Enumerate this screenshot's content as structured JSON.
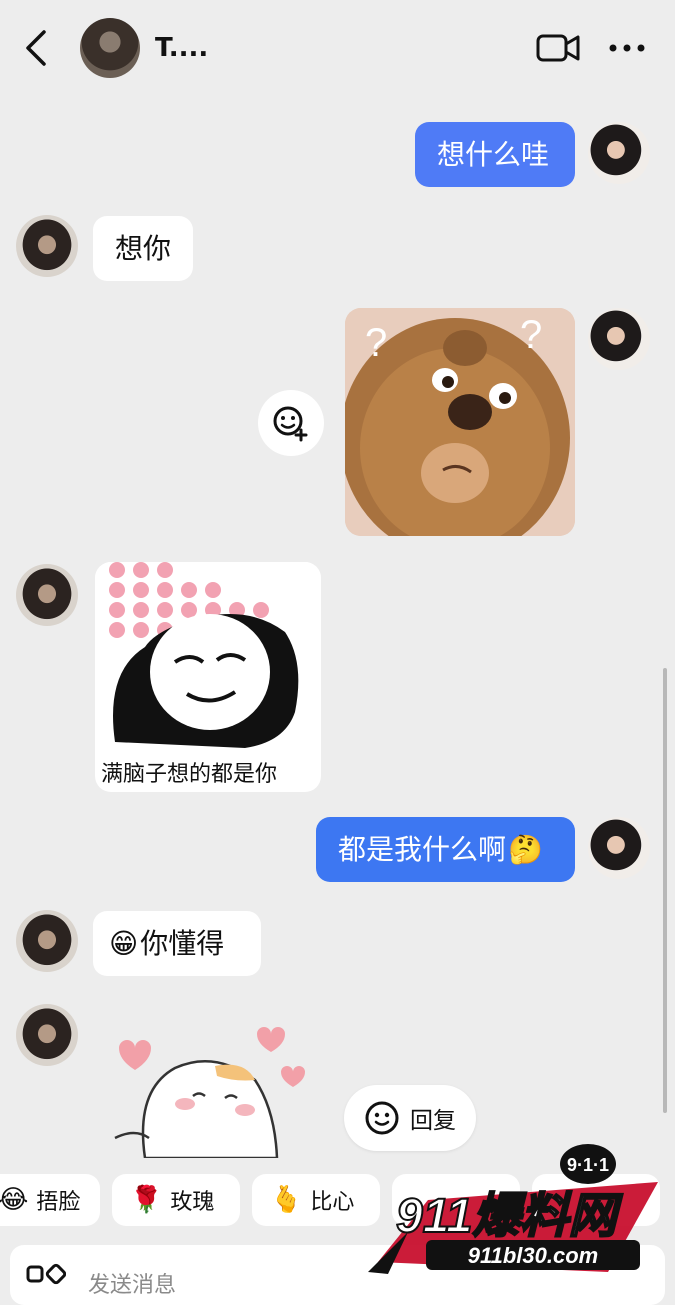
{
  "header": {
    "contact_name": "T....",
    "back_icon": "chevron-left-icon",
    "video_icon": "video-camera-icon",
    "more_icon": "more-horizontal-icon"
  },
  "messages": [
    {
      "side": "out",
      "type": "text",
      "text": "想什么哇"
    },
    {
      "side": "in",
      "type": "text",
      "text": "想你"
    },
    {
      "side": "out",
      "type": "sticker",
      "description": "bear-sticker"
    },
    {
      "side": "in",
      "type": "sticker",
      "caption": "满脑子想的都是你"
    },
    {
      "side": "out",
      "type": "text",
      "text": "都是我什么啊",
      "emoji": "🤔"
    },
    {
      "side": "in",
      "type": "text",
      "text": "你懂得",
      "emoji": "😁"
    },
    {
      "side": "in",
      "type": "sticker",
      "description": "cat-sticker"
    }
  ],
  "reply_button": {
    "label": "回复"
  },
  "quick_replies": [
    {
      "emoji": "😂",
      "label": "捂脸"
    },
    {
      "emoji": "🌹",
      "label": "玫瑰"
    },
    {
      "emoji": "🫰",
      "label": "比心"
    }
  ],
  "input": {
    "placeholder": "发送消息"
  },
  "watermark": {
    "badge": "9·1·1",
    "title": "911爆料网",
    "url": "911bl30.com"
  },
  "colors": {
    "outgoing_bubble": "#4f7bf6",
    "background": "#ededed",
    "incoming_bubble": "#ffffff"
  }
}
